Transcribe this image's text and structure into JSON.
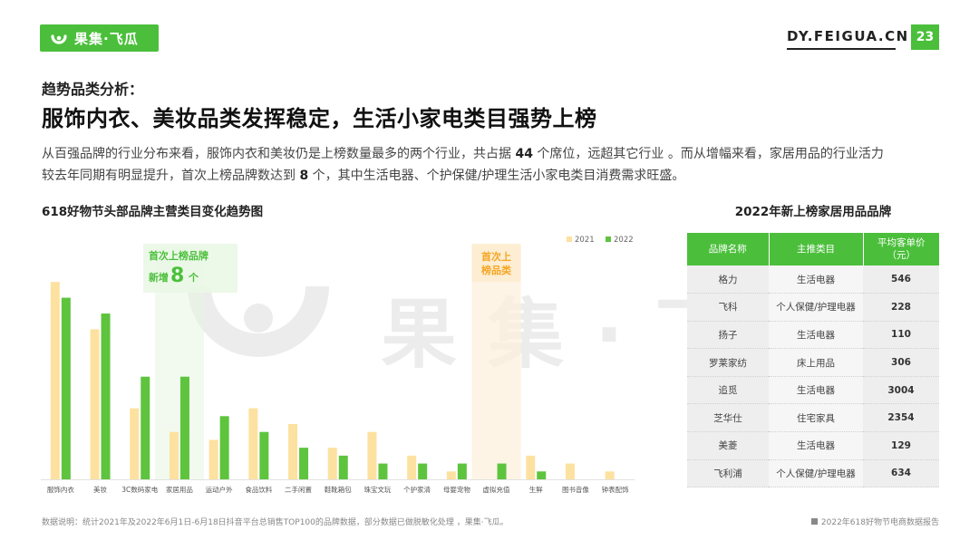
{
  "header": {
    "logo_text": "果集·飞瓜",
    "site_url": "DY.FEIGUA.CN",
    "page_number": "23"
  },
  "section_label": "趋势品类分析：",
  "headline": "服饰内衣、美妆品类发挥稳定，生活小家电类目强势上榜",
  "body": {
    "line1_a": "从百强品牌的行业分布来看，服饰内衣和美妆仍是上榜数量最多的两个行业，共占据 ",
    "line1_num": "44",
    "line1_b": " 个席位，远超其它行业 。而从增幅来看，家居用品的行业活力",
    "line2_a": "较去年同期有明显提升，首次上榜品牌数达到 ",
    "line2_num": "8",
    "line2_b": " 个，其中生活电器、个护保健/护理生活小家电类目消费需求旺盛。"
  },
  "chart_title": "618好物节头部品牌主营类目变化趋势图",
  "chart_data": {
    "type": "bar",
    "categories": [
      "服饰内衣",
      "美妆",
      "3C数码家电",
      "家居用品",
      "运动户外",
      "食品饮料",
      "二手闲置",
      "鞋靴箱包",
      "珠宝文玩",
      "个护家清",
      "母婴宠物",
      "虚拟充值",
      "生鲜",
      "图书音像",
      "钟表配饰"
    ],
    "series": [
      {
        "name": "2021",
        "color": "#fde1a0",
        "values": [
          25,
          19,
          9,
          6,
          5,
          9,
          7,
          4,
          6,
          3,
          1,
          0,
          3,
          2,
          1
        ]
      },
      {
        "name": "2022",
        "color": "#5ec43e",
        "values": [
          23,
          21,
          13,
          13,
          8,
          6,
          4,
          3,
          2,
          2,
          2,
          2,
          1,
          0,
          0
        ]
      }
    ],
    "legend_position": "top-right",
    "ylim": [
      0,
      28
    ],
    "annotations": [
      {
        "category": "家居用品",
        "text1": "首次上榜品牌",
        "text2_prefix": "新增",
        "text2_value": "8",
        "text2_suffix": "个",
        "color": "#4bbf3b"
      },
      {
        "category": "虚拟充值",
        "text1": "首次上",
        "text2": "榜品类",
        "color": "#f5a623"
      }
    ]
  },
  "table": {
    "title": "2022年新上榜家居用品品牌",
    "headers": [
      "品牌名称",
      "主推类目",
      "平均客单价",
      "（元）"
    ],
    "rows": [
      {
        "brand": "格力",
        "category": "生活电器",
        "price": "546"
      },
      {
        "brand": "飞科",
        "category": "个人保健/护理电器",
        "price": "228"
      },
      {
        "brand": "扬子",
        "category": "生活电器",
        "price": "110"
      },
      {
        "brand": "罗莱家纺",
        "category": "床上用品",
        "price": "306"
      },
      {
        "brand": "追觅",
        "category": "生活电器",
        "price": "3004"
      },
      {
        "brand": "芝华仕",
        "category": "住宅家具",
        "price": "2354"
      },
      {
        "brand": "美菱",
        "category": "生活电器",
        "price": "129"
      },
      {
        "brand": "飞利浦",
        "category": "个人保健/护理电器",
        "price": "634"
      }
    ]
  },
  "footer": {
    "note": "数据说明：统计2021年及2022年6月1日-6月18日抖音平台总销售TOP100的品牌数据，部分数据已做脱敏化处理 ，果集·飞瓜。",
    "report": "2022年618好物节电商数据报告"
  },
  "colors": {
    "brand_green": "#4bbf3b",
    "bar_2021": "#fde1a0",
    "bar_2022": "#5ec43e",
    "highlight_orange": "#f5a623"
  }
}
